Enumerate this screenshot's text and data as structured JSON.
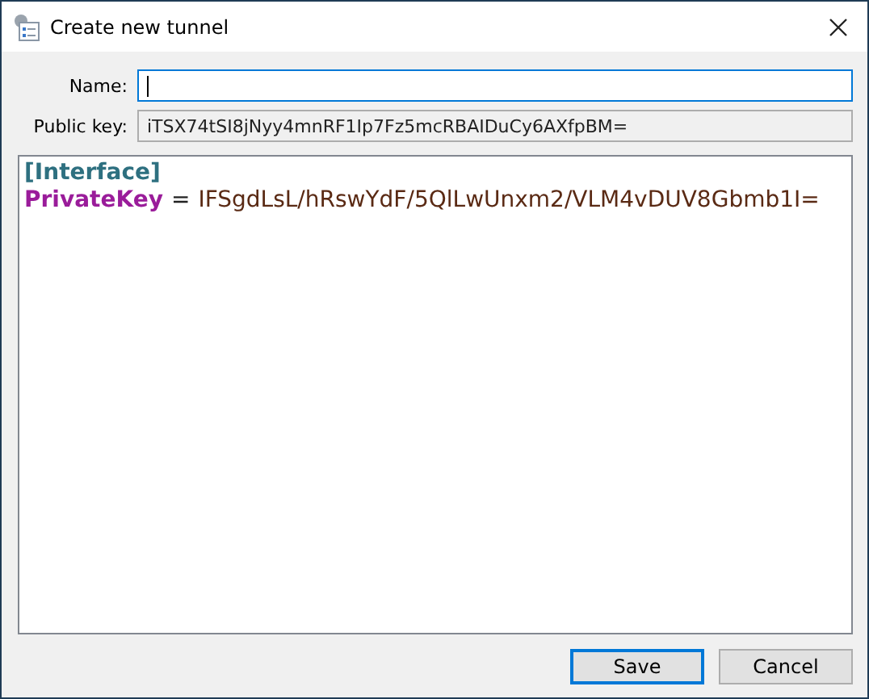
{
  "window": {
    "title": "Create new tunnel"
  },
  "name_field": {
    "label": "Name:",
    "focused": true
  },
  "public_key": {
    "label": "Public key:",
    "value": "iTSX74tSI8jNyy4mnRF1Ip7Fz5mcRBAIDuCy6AXfpBM="
  },
  "editor": {
    "lines": [
      [
        {
          "kind": "section",
          "text": "[Interface]"
        }
      ],
      [
        {
          "kind": "key",
          "text": "PrivateKey"
        },
        {
          "kind": "operator",
          "text": "="
        },
        {
          "kind": "value",
          "text": "IFSgdLsL/hRswYdF/5QlLwUnxm2/VLM4vDUV8Gbmb1I="
        }
      ]
    ]
  },
  "buttons": [
    {
      "label": "Save",
      "default": true
    },
    {
      "label": "Cancel",
      "default": false
    }
  ]
}
